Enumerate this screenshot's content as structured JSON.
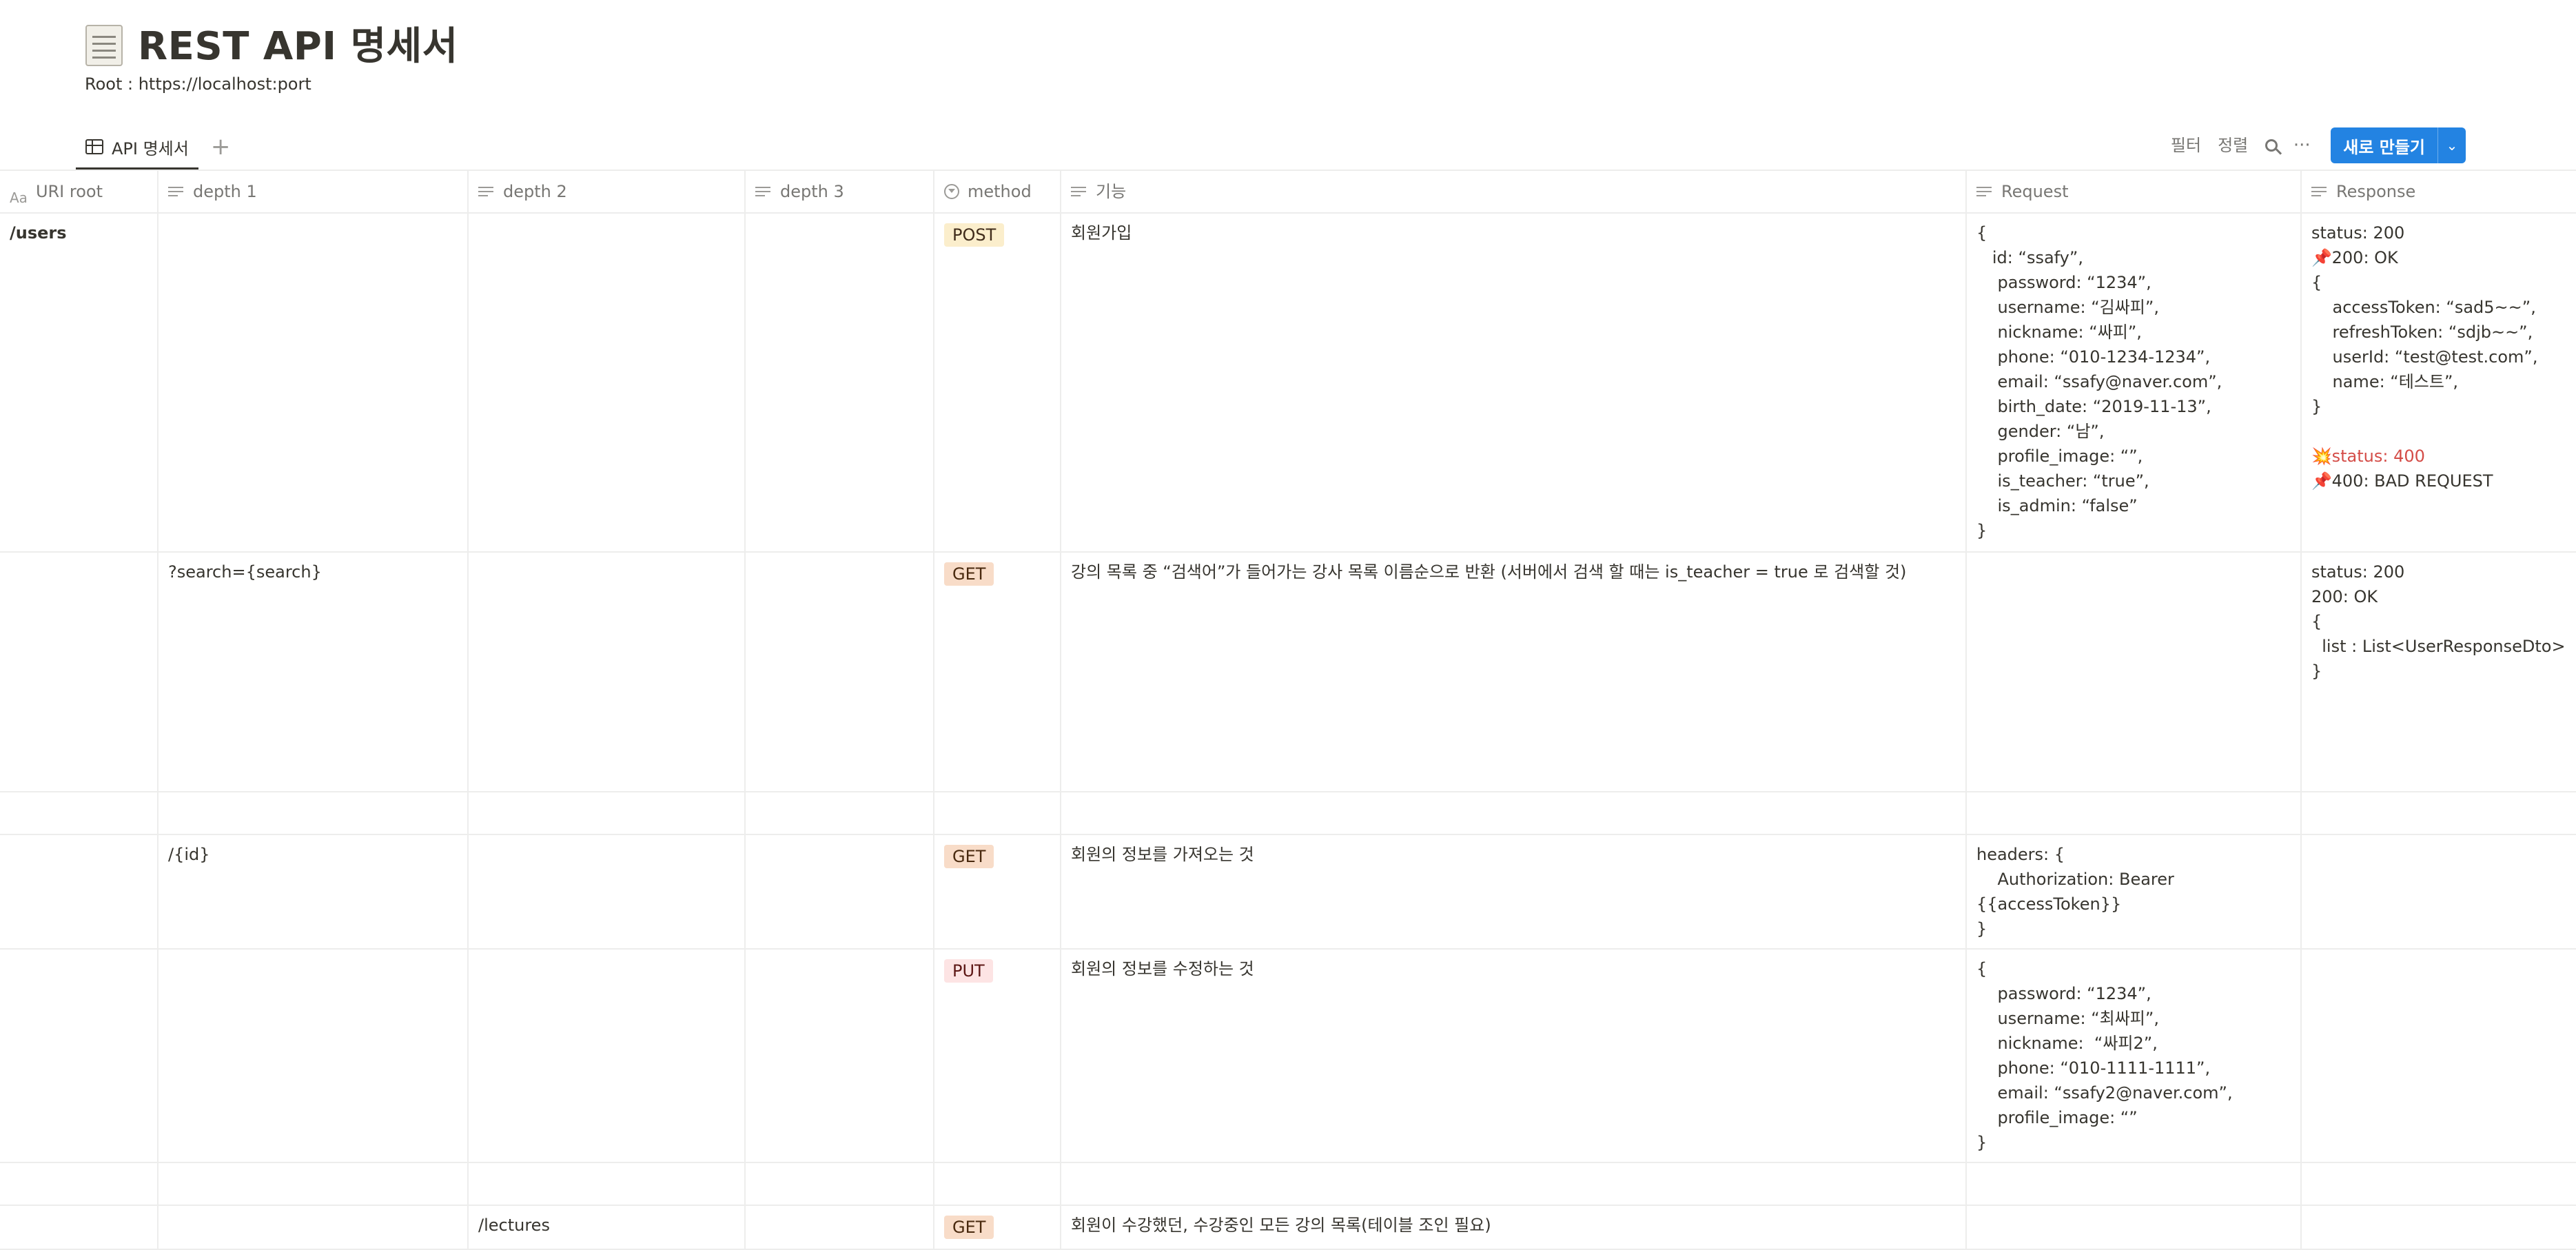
{
  "page": {
    "title": "REST API 명세서",
    "root_line": "Root : https://localhost:port"
  },
  "tabs": {
    "active_label": "API 명세서",
    "add_glyph": "+"
  },
  "toolbar": {
    "filter_label": "필터",
    "sort_label": "정렬",
    "more_glyph": "···",
    "new_label": "새로 만들기",
    "new_arrow_glyph": "⌄"
  },
  "columns": {
    "uri_prefix": "Aa",
    "uri": "URI root",
    "depth1": "depth 1",
    "depth2": "depth 2",
    "depth3": "depth 3",
    "method": "method",
    "feature": "기능",
    "request": "Request",
    "response": "Response"
  },
  "method_colors": {
    "POST": {
      "bg": "#fbeecc",
      "fg": "#402c1b"
    },
    "GET": {
      "bg": "#f8dcc8",
      "fg": "#49290e"
    },
    "PUT": {
      "bg": "#fde4e4",
      "fg": "#5d1715"
    }
  },
  "rows": [
    {
      "uri": "/users",
      "depth1": "",
      "depth2": "",
      "depth3": "",
      "method": "POST",
      "feature": "회원가입",
      "request": "{\n   id: “ssafy”,\n    password: “1234”,\n    username: “김싸피”,\n    nickname: “싸피”,\n    phone: “010-1234-1234”,\n    email: “ssafy@naver.com”,\n    birth_date: “2019-11-13”,\n    gender: “남”,\n    profile_image: “”,\n    is_teacher: “true”,\n    is_admin: “false”\n}",
      "resp_status": "status: 200",
      "resp_ok_icon": "📌",
      "resp_ok": "200: OK",
      "resp_body": "{\n    accessToken: “sad5~~”,\n    refreshToken: “sdjb~~”,\n    userId: “test@test.com”,\n    name: “테스트”,\n}",
      "resp_err_icon": "💥",
      "resp_err_status": "status: 400",
      "resp_err_icon2": "📌",
      "resp_err": "400: BAD REQUEST"
    },
    {
      "uri": "",
      "depth1": "?search={search}",
      "depth2": "",
      "depth3": "",
      "method": "GET",
      "feature": "강의 목록 중 “검색어”가 들어가는 강사 목록 이름순으로 반환 (서버에서 검색 할 때는 is_teacher = true 로 검색할 것)",
      "request": "",
      "response": "status: 200\n200: OK\n{\n  list : List<UserResponseDto>\n}"
    },
    {
      "uri": "",
      "depth1": "",
      "depth2": "",
      "depth3": "",
      "method": "",
      "feature": "",
      "request": "",
      "response": ""
    },
    {
      "uri": "",
      "depth1": "/{id}",
      "depth2": "",
      "depth3": "",
      "method": "GET",
      "feature": "회원의 정보를 가져오는 것",
      "request": "headers: {\n    Authorization: Bearer\n{{accessToken}}\n}",
      "response": ""
    },
    {
      "uri": "",
      "depth1": "",
      "depth2": "",
      "depth3": "",
      "method": "PUT",
      "feature": "회원의 정보를 수정하는 것",
      "request": "{\n    password: “1234”,\n    username: “최싸피”,\n    nickname:  “싸피2”,\n    phone: “010-1111-1111”,\n    email: “ssafy2@naver.com”,\n    profile_image: “”\n}",
      "response": ""
    },
    {
      "uri": "",
      "depth1": "",
      "depth2": "",
      "depth3": "",
      "method": "",
      "feature": "",
      "request": "",
      "response": ""
    },
    {
      "uri": "",
      "depth1": "",
      "depth2": "/lectures",
      "depth3": "",
      "method": "GET",
      "feature": "회원이 수강했던, 수강중인 모든 강의 목록(테이블 조인 필요)",
      "request": "",
      "response": ""
    }
  ]
}
